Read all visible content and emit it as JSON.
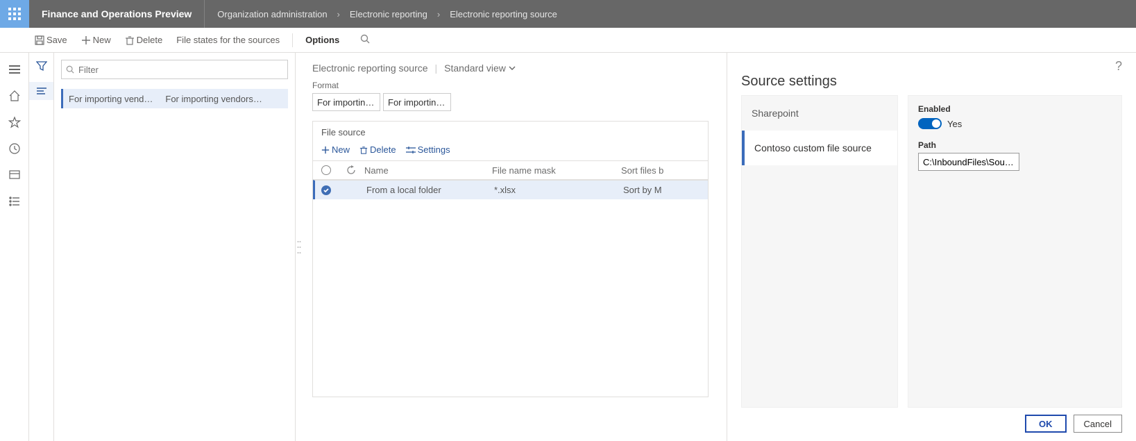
{
  "header": {
    "app_title": "Finance and Operations Preview",
    "breadcrumb": [
      "Organization administration",
      "Electronic reporting",
      "Electronic reporting source"
    ]
  },
  "cmdbar": {
    "save": "Save",
    "new": "New",
    "delete": "Delete",
    "file_states": "File states for the sources",
    "options": "Options"
  },
  "filter": {
    "placeholder": "Filter"
  },
  "list": {
    "row1_col1": "For importing vend…",
    "row1_col2": "For importing vendors'…"
  },
  "main": {
    "title": "Electronic reporting source",
    "view_label": "Standard view",
    "format_label": "Format",
    "format_cell1": "For importin…",
    "format_cell2": "For importin…",
    "card": {
      "title": "File source",
      "new": "New",
      "delete": "Delete",
      "settings": "Settings",
      "columns": {
        "name": "Name",
        "mask": "File name mask",
        "sort": "Sort files b"
      },
      "rows": [
        {
          "name": "From a local folder",
          "mask": "*.xlsx",
          "sort": "Sort by M"
        }
      ]
    }
  },
  "panel": {
    "title": "Source settings",
    "tabs": {
      "sharepoint": "Sharepoint",
      "custom": "Contoso custom file source"
    },
    "form": {
      "enabled_label": "Enabled",
      "enabled_value": "Yes",
      "path_label": "Path",
      "path_value": "C:\\InboundFiles\\Sou…"
    },
    "footer": {
      "ok": "OK",
      "cancel": "Cancel"
    }
  }
}
